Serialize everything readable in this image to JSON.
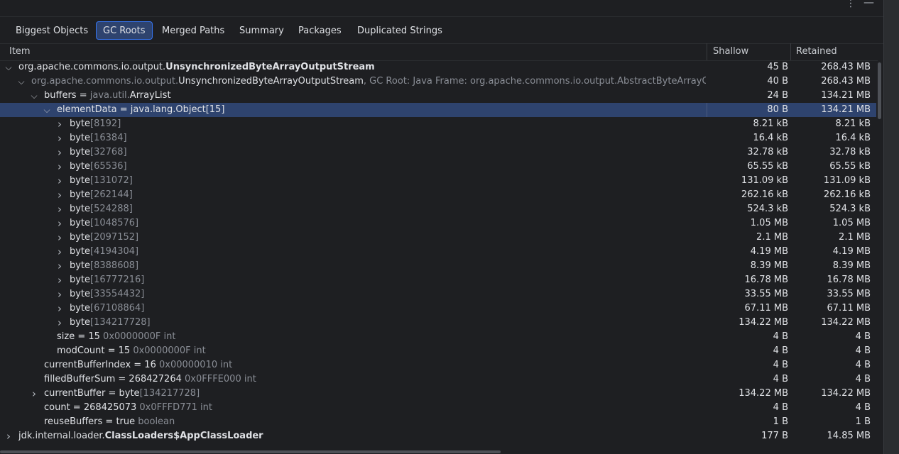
{
  "window": {
    "more_glyph": "⋮",
    "minimize_glyph": "—"
  },
  "tabs": [
    {
      "label": "Biggest Objects",
      "active": false
    },
    {
      "label": "GC Roots",
      "active": true
    },
    {
      "label": "Merged Paths",
      "active": false
    },
    {
      "label": "Summary",
      "active": false
    },
    {
      "label": "Packages",
      "active": false
    },
    {
      "label": "Duplicated Strings",
      "active": false
    }
  ],
  "columns": {
    "item": "Item",
    "shallow": "Shallow",
    "retained": "Retained"
  },
  "rows": [
    {
      "level": 0,
      "arrow": "down",
      "parts": [
        {
          "t": "org.apache.commons.io.output."
        },
        {
          "t": "UnsynchronizedByteArrayOutputStream",
          "s": "bold"
        }
      ],
      "shallow": "45 B",
      "retained": "268.43 MB"
    },
    {
      "level": 1,
      "arrow": "down",
      "dim": true,
      "parts": [
        {
          "t": "org.apache.commons.io.output.",
          "s": "gray"
        },
        {
          "t": "UnsynchronizedByteArrayOutputStream"
        },
        {
          "t": ", GC Root: Java Frame: org.apache.commons.io.output.AbstractByteArrayOutputStream",
          "s": "gray"
        }
      ],
      "shallow": "40 B",
      "retained": "268.43 MB"
    },
    {
      "level": 2,
      "arrow": "down",
      "parts": [
        {
          "t": "buffers = "
        },
        {
          "t": "java.util.",
          "s": "gray"
        },
        {
          "t": "ArrayList"
        }
      ],
      "shallow": "24 B",
      "retained": "134.21 MB"
    },
    {
      "level": 3,
      "arrow": "down",
      "selected": true,
      "parts": [
        {
          "t": "elementData = java.lang.Object[15]"
        }
      ],
      "shallow": "80 B",
      "retained": "134.21 MB"
    },
    {
      "level": 4,
      "arrow": "right",
      "parts": [
        {
          "t": "byte"
        },
        {
          "t": "[8192]",
          "s": "gray"
        }
      ],
      "shallow": "8.21 kB",
      "retained": "8.21 kB"
    },
    {
      "level": 4,
      "arrow": "right",
      "parts": [
        {
          "t": "byte"
        },
        {
          "t": "[16384]",
          "s": "gray"
        }
      ],
      "shallow": "16.4 kB",
      "retained": "16.4 kB"
    },
    {
      "level": 4,
      "arrow": "right",
      "parts": [
        {
          "t": "byte"
        },
        {
          "t": "[32768]",
          "s": "gray"
        }
      ],
      "shallow": "32.78 kB",
      "retained": "32.78 kB"
    },
    {
      "level": 4,
      "arrow": "right",
      "parts": [
        {
          "t": "byte"
        },
        {
          "t": "[65536]",
          "s": "gray"
        }
      ],
      "shallow": "65.55 kB",
      "retained": "65.55 kB"
    },
    {
      "level": 4,
      "arrow": "right",
      "parts": [
        {
          "t": "byte"
        },
        {
          "t": "[131072]",
          "s": "gray"
        }
      ],
      "shallow": "131.09 kB",
      "retained": "131.09 kB"
    },
    {
      "level": 4,
      "arrow": "right",
      "parts": [
        {
          "t": "byte"
        },
        {
          "t": "[262144]",
          "s": "gray"
        }
      ],
      "shallow": "262.16 kB",
      "retained": "262.16 kB"
    },
    {
      "level": 4,
      "arrow": "right",
      "parts": [
        {
          "t": "byte"
        },
        {
          "t": "[524288]",
          "s": "gray"
        }
      ],
      "shallow": "524.3 kB",
      "retained": "524.3 kB"
    },
    {
      "level": 4,
      "arrow": "right",
      "parts": [
        {
          "t": "byte"
        },
        {
          "t": "[1048576]",
          "s": "gray"
        }
      ],
      "shallow": "1.05 MB",
      "retained": "1.05 MB"
    },
    {
      "level": 4,
      "arrow": "right",
      "parts": [
        {
          "t": "byte"
        },
        {
          "t": "[2097152]",
          "s": "gray"
        }
      ],
      "shallow": "2.1 MB",
      "retained": "2.1 MB"
    },
    {
      "level": 4,
      "arrow": "right",
      "parts": [
        {
          "t": "byte"
        },
        {
          "t": "[4194304]",
          "s": "gray"
        }
      ],
      "shallow": "4.19 MB",
      "retained": "4.19 MB"
    },
    {
      "level": 4,
      "arrow": "right",
      "parts": [
        {
          "t": "byte"
        },
        {
          "t": "[8388608]",
          "s": "gray"
        }
      ],
      "shallow": "8.39 MB",
      "retained": "8.39 MB"
    },
    {
      "level": 4,
      "arrow": "right",
      "parts": [
        {
          "t": "byte"
        },
        {
          "t": "[16777216]",
          "s": "gray"
        }
      ],
      "shallow": "16.78 MB",
      "retained": "16.78 MB"
    },
    {
      "level": 4,
      "arrow": "right",
      "parts": [
        {
          "t": "byte"
        },
        {
          "t": "[33554432]",
          "s": "gray"
        }
      ],
      "shallow": "33.55 MB",
      "retained": "33.55 MB"
    },
    {
      "level": 4,
      "arrow": "right",
      "parts": [
        {
          "t": "byte"
        },
        {
          "t": "[67108864]",
          "s": "gray"
        }
      ],
      "shallow": "67.11 MB",
      "retained": "67.11 MB"
    },
    {
      "level": 4,
      "arrow": "right",
      "parts": [
        {
          "t": "byte"
        },
        {
          "t": "[134217728]",
          "s": "gray"
        }
      ],
      "shallow": "134.22 MB",
      "retained": "134.22 MB"
    },
    {
      "level": 3,
      "arrow": "none",
      "parts": [
        {
          "t": "size = 15 "
        },
        {
          "t": "0x0000000F  int",
          "s": "gray"
        }
      ],
      "shallow": "4 B",
      "retained": "4 B"
    },
    {
      "level": 3,
      "arrow": "none",
      "parts": [
        {
          "t": "modCount = 15 "
        },
        {
          "t": "0x0000000F  int",
          "s": "gray"
        }
      ],
      "shallow": "4 B",
      "retained": "4 B"
    },
    {
      "level": 2,
      "arrow": "none",
      "parts": [
        {
          "t": "currentBufferIndex = 16 "
        },
        {
          "t": "0x00000010  int",
          "s": "gray"
        }
      ],
      "shallow": "4 B",
      "retained": "4 B"
    },
    {
      "level": 2,
      "arrow": "none",
      "parts": [
        {
          "t": "filledBufferSum = 268427264 "
        },
        {
          "t": "0x0FFFE000  int",
          "s": "gray"
        }
      ],
      "shallow": "4 B",
      "retained": "4 B"
    },
    {
      "level": 2,
      "arrow": "right",
      "parts": [
        {
          "t": "currentBuffer = byte"
        },
        {
          "t": "[134217728]",
          "s": "gray"
        }
      ],
      "shallow": "134.22 MB",
      "retained": "134.22 MB"
    },
    {
      "level": 2,
      "arrow": "none",
      "parts": [
        {
          "t": "count = 268425073 "
        },
        {
          "t": "0x0FFFD771  int",
          "s": "gray"
        }
      ],
      "shallow": "4 B",
      "retained": "4 B"
    },
    {
      "level": 2,
      "arrow": "none",
      "parts": [
        {
          "t": "reuseBuffers = true "
        },
        {
          "t": "boolean",
          "s": "gray"
        }
      ],
      "shallow": "1 B",
      "retained": "1 B"
    },
    {
      "level": 0,
      "arrow": "right",
      "parts": [
        {
          "t": "jdk.internal.loader."
        },
        {
          "t": "ClassLoaders$AppClassLoader",
          "s": "bold"
        }
      ],
      "shallow": "177 B",
      "retained": "14.85 MB"
    }
  ]
}
